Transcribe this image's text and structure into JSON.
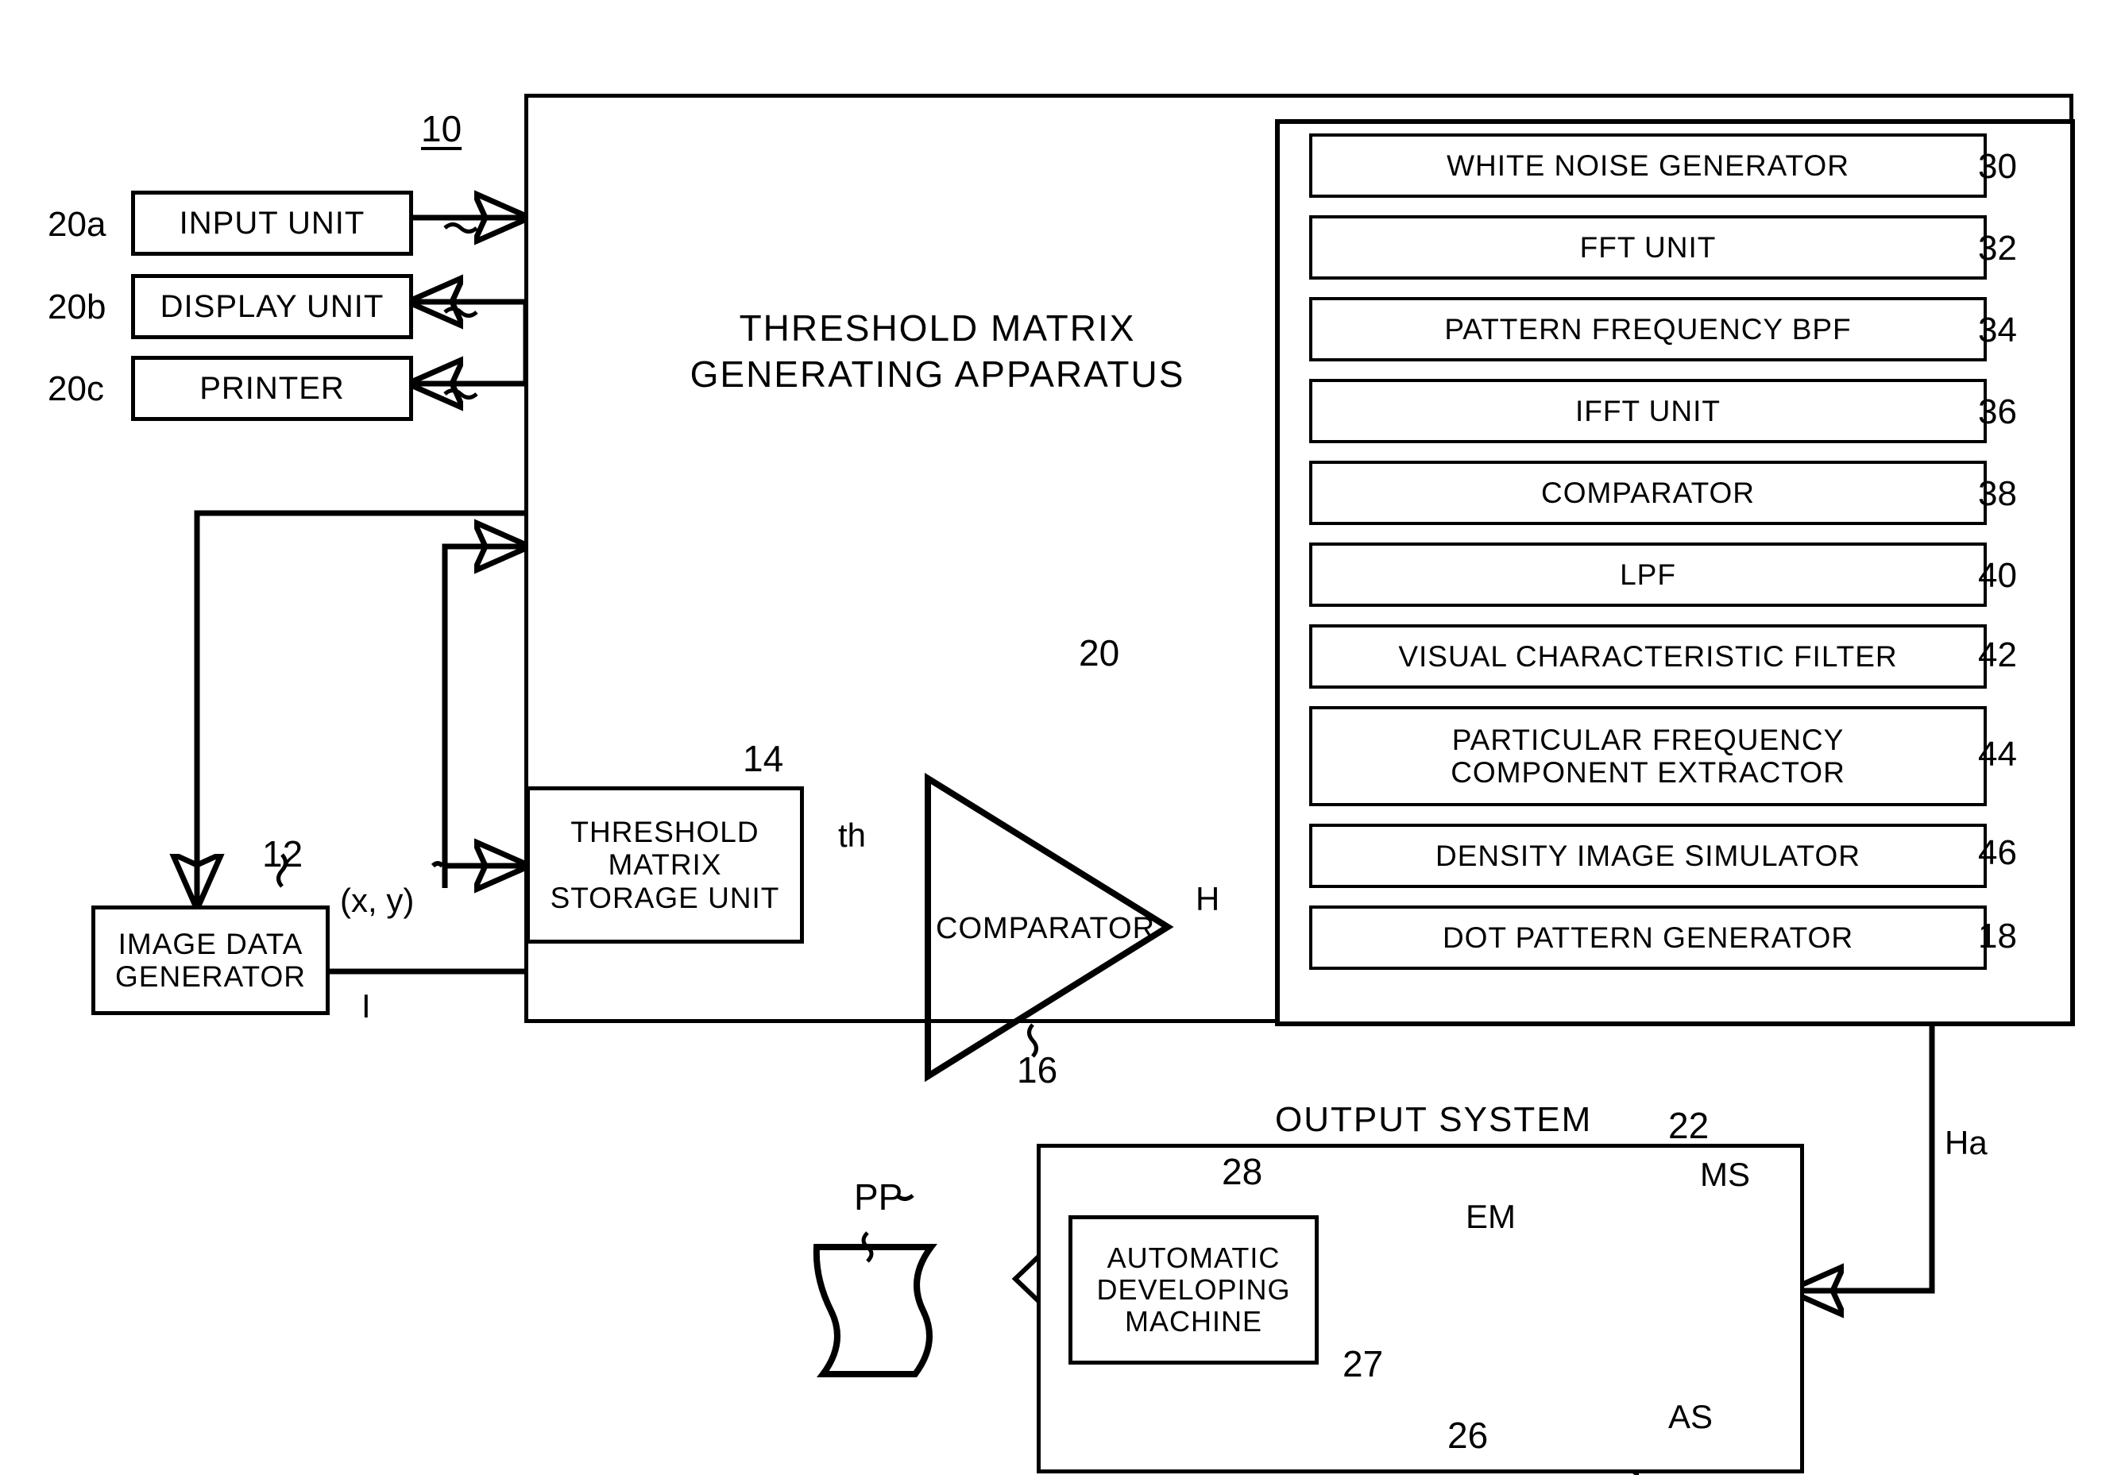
{
  "figure": {
    "main_apparatus": {
      "title_line1": "THRESHOLD MATRIX",
      "title_line2": "GENERATING APPARATUS",
      "ref_top": "10",
      "ref_bottom": "20"
    },
    "peripherals": [
      {
        "label": "INPUT UNIT",
        "ref": "20a"
      },
      {
        "label": "DISPLAY UNIT",
        "ref": "20b"
      },
      {
        "label": "PRINTER",
        "ref": "20c"
      }
    ],
    "modules": [
      {
        "label": "WHITE NOISE GENERATOR",
        "ref": "30"
      },
      {
        "label": "FFT UNIT",
        "ref": "32"
      },
      {
        "label": "PATTERN FREQUENCY BPF",
        "ref": "34"
      },
      {
        "label": "IFFT UNIT",
        "ref": "36"
      },
      {
        "label": "COMPARATOR",
        "ref": "38"
      },
      {
        "label": "LPF",
        "ref": "40"
      },
      {
        "label": "VISUAL CHARACTERISTIC FILTER",
        "ref": "42"
      },
      {
        "label_line1": "PARTICULAR FREQUENCY",
        "label_line2": "COMPONENT EXTRACTOR",
        "ref": "44"
      },
      {
        "label": "DENSITY IMAGE SIMULATOR",
        "ref": "46"
      },
      {
        "label": "DOT PATTERN GENERATOR",
        "ref": "18"
      }
    ],
    "image_data_generator": {
      "line1": "IMAGE DATA",
      "line2": "GENERATOR",
      "ref": "12"
    },
    "threshold_matrix_storage": {
      "line1": "THRESHOLD",
      "line2": "MATRIX",
      "line3": "STORAGE UNIT",
      "ref": "14"
    },
    "comparator": {
      "label": "COMPARATOR",
      "ref": "16"
    },
    "signals": {
      "coords": "(x, y)",
      "threshold": "th",
      "image": "I",
      "halftone": "H",
      "halftone_out": "Ha"
    },
    "output_system": {
      "title": "OUTPUT SYSTEM",
      "ref": "22",
      "developing_machine": {
        "line1": "AUTOMATIC",
        "line2": "DEVELOPING",
        "line3": "MACHINE",
        "ref": "28"
      },
      "drum_ref": "27",
      "head_ref": "26",
      "emulsion_label": "EM",
      "main_scan_label": "MS",
      "aux_scan_label": "AS",
      "print_label": "PP"
    }
  }
}
